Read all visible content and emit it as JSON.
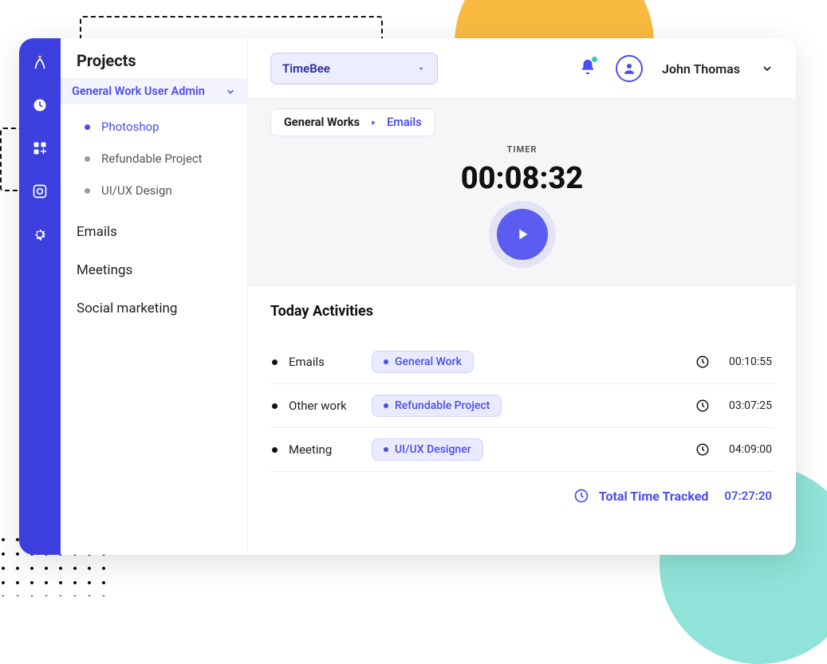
{
  "sidebar": {
    "title": "Projects",
    "group_label": "General Work User Admin",
    "sub_items": [
      {
        "label": "Photoshop",
        "active": true
      },
      {
        "label": "Refundable Project",
        "active": false
      },
      {
        "label": "UI/UX Design",
        "active": false
      }
    ],
    "items": [
      {
        "label": "Emails"
      },
      {
        "label": "Meetings"
      },
      {
        "label": "Social marketing"
      }
    ]
  },
  "rail_icons": [
    "logo-icon",
    "clock-icon",
    "apps-icon",
    "screenshots-icon",
    "gear-icon"
  ],
  "header": {
    "workspace": "TimeBee",
    "user_name": "John Thomas",
    "notification_active": true
  },
  "breadcrumb": {
    "root": "General Works",
    "leaf": "Emails"
  },
  "timer": {
    "label": "TIMER",
    "value": "00:08:32"
  },
  "activities": {
    "title": "Today Activities",
    "rows": [
      {
        "name": "Emails",
        "tag": "General Work",
        "time": "00:10:55"
      },
      {
        "name": "Other work",
        "tag": "Refundable Project",
        "time": "03:07:25"
      },
      {
        "name": "Meeting",
        "tag": "UI/UX Designer",
        "time": "04:09:00"
      }
    ],
    "total_label": "Total Time Tracked",
    "total_time": "07:27:20"
  }
}
